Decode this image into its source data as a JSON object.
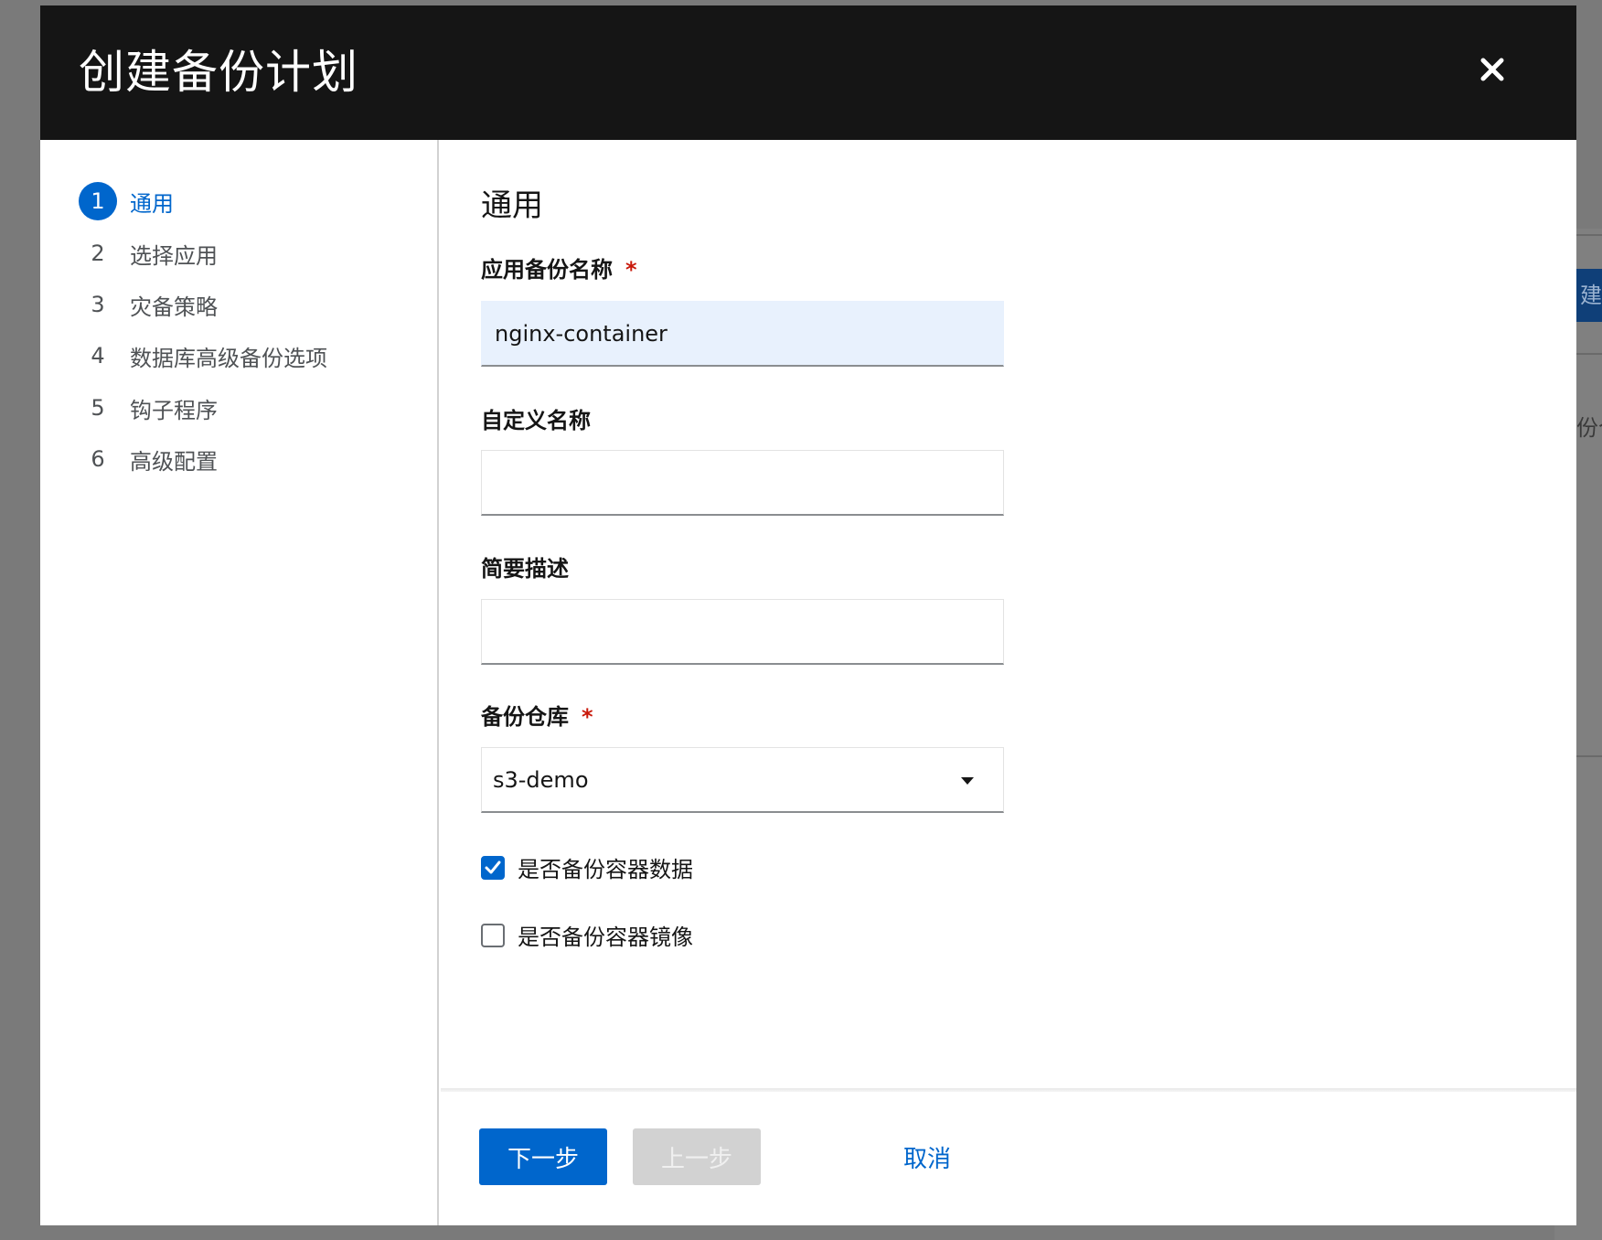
{
  "background": {
    "button_fragment": "建",
    "text_fragment": "份仓"
  },
  "modal": {
    "title": "创建备份计划",
    "close_icon": "close-icon"
  },
  "wizard": {
    "steps": [
      {
        "number": "1",
        "label": "通用",
        "active": true
      },
      {
        "number": "2",
        "label": "选择应用",
        "active": false
      },
      {
        "number": "3",
        "label": "灾备策略",
        "active": false
      },
      {
        "number": "4",
        "label": "数据库高级备份选项",
        "active": false
      },
      {
        "number": "5",
        "label": "钩子程序",
        "active": false
      },
      {
        "number": "6",
        "label": "高级配置",
        "active": false
      }
    ]
  },
  "form": {
    "section_title": "通用",
    "backup_name": {
      "label": "应用备份名称",
      "required_mark": "*",
      "value": "nginx-container"
    },
    "custom_name": {
      "label": "自定义名称",
      "value": ""
    },
    "description": {
      "label": "简要描述",
      "value": ""
    },
    "repository": {
      "label": "备份仓库",
      "required_mark": "*",
      "selected": "s3-demo"
    },
    "backup_container_data": {
      "label": "是否备份容器数据",
      "checked": true
    },
    "backup_container_image": {
      "label": "是否备份容器镜像",
      "checked": false
    }
  },
  "footer": {
    "next_label": "下一步",
    "back_label": "上一步",
    "cancel_label": "取消"
  },
  "colors": {
    "accent": "#0066cc",
    "header_bg": "#151515",
    "required": "#c9190b",
    "disabled": "#d2d2d2"
  }
}
